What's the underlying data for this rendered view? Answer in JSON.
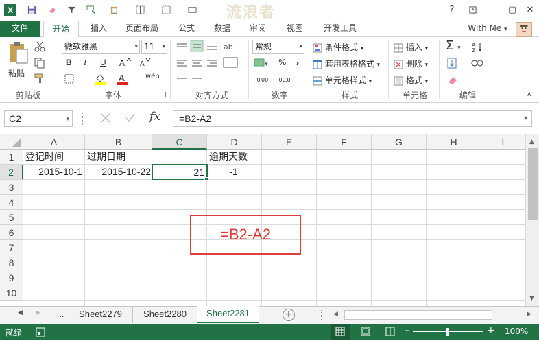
{
  "title_bar": {
    "watermark": "流浪者",
    "app_letter": "X",
    "minimize": "–",
    "restore": "▢",
    "close": "✕",
    "help": "?"
  },
  "tabs": [
    "文件",
    "开始",
    "插入",
    "页面布局",
    "公式",
    "数据",
    "审阅",
    "视图",
    "开发工具"
  ],
  "account": "With Me",
  "ribbon": {
    "clipboard": {
      "paste": "粘贴",
      "label": "剪贴板"
    },
    "font": {
      "name": "微软雅黑",
      "size": "11",
      "label": "字体",
      "bold": "B",
      "italic": "I",
      "underline": "U"
    },
    "alignment": {
      "label": "对齐方式"
    },
    "number": {
      "format": "常规",
      "percent": "%",
      "comma": ",",
      "label": "数字"
    },
    "styles": {
      "conditional": "条件格式",
      "table": "套用表格格式",
      "cell": "单元格样式",
      "label": "样式"
    },
    "cells": {
      "insert": "插入",
      "delete": "删除",
      "format": "格式",
      "label": "单元格"
    },
    "editing": {
      "label": "编辑"
    }
  },
  "formula_bar": {
    "name_box": "C2",
    "fx": "fx",
    "formula": "=B2-A2"
  },
  "columns": [
    "A",
    "B",
    "C",
    "D",
    "E",
    "F",
    "G",
    "H",
    "I"
  ],
  "rows": [
    "1",
    "2",
    "3",
    "4",
    "5",
    "6",
    "7",
    "8",
    "9",
    "10"
  ],
  "cells": {
    "A1": "登记时间",
    "B1": "过期日期",
    "D1": "逾期天数",
    "A2": "2015-10-1",
    "B2": "2015-10-22",
    "C2": "21",
    "D2": "-1"
  },
  "annotation": "=B2-A2",
  "sheets": {
    "ellipsis": "...",
    "tabs": [
      "Sheet2279",
      "Sheet2280",
      "Sheet2281"
    ],
    "active": "Sheet2281",
    "add": "+"
  },
  "status": {
    "ready": "就绪",
    "zoom": "100%",
    "zoom_minus": "–",
    "zoom_plus": "+"
  },
  "colors": {
    "accent": "#217346",
    "annotation_box": "#e03c3c"
  }
}
